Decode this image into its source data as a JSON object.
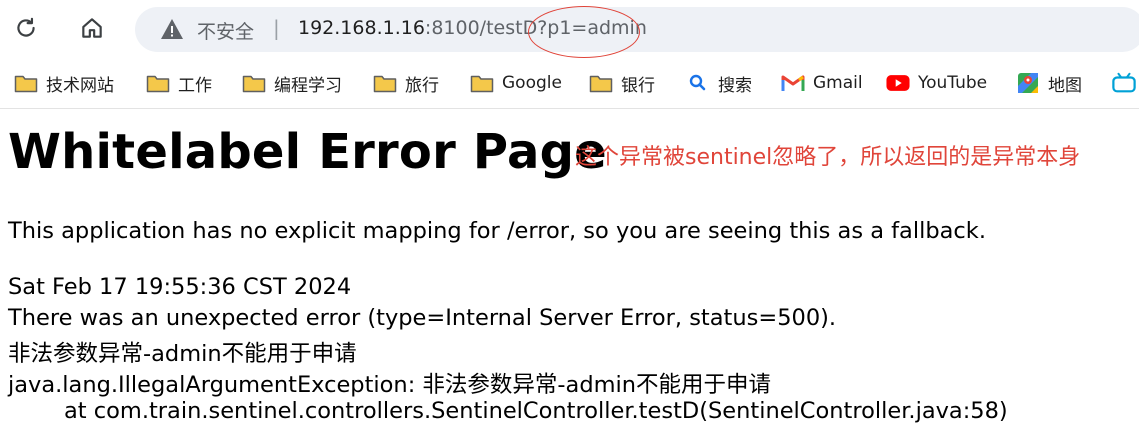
{
  "address_bar": {
    "security_label": "不安全",
    "separator": "|",
    "url_host": "192.168.1.16",
    "url_rest": ":8100/testD?p1=admin"
  },
  "bookmarks": [
    {
      "label": "技术网站",
      "icon": "folder-icon"
    },
    {
      "label": "工作",
      "icon": "folder-icon"
    },
    {
      "label": "编程学习",
      "icon": "folder-icon"
    },
    {
      "label": "旅行",
      "icon": "folder-icon"
    },
    {
      "label": "Google",
      "icon": "folder-icon"
    },
    {
      "label": "银行",
      "icon": "folder-icon"
    },
    {
      "label": "搜索",
      "icon": "search-icon"
    },
    {
      "label": "Gmail",
      "icon": "gmail-icon"
    },
    {
      "label": "YouTube",
      "icon": "youtube-icon"
    },
    {
      "label": "地图",
      "icon": "maps-icon"
    }
  ],
  "page": {
    "heading": "Whitelabel Error Page",
    "annotation": "这个异常被sentinel忽略了，所以返回的是异常本身",
    "description": "This application has no explicit mapping for /error, so you are seeing this as a fallback.",
    "timestamp": "Sat Feb 17 19:55:36 CST 2024",
    "error_summary": "There was an unexpected error (type=Internal Server Error, status=500).",
    "error_message": "非法参数异常-admin不能用于申请",
    "exception": "java.lang.IllegalArgumentException: 非法参数异常-admin不能用于申请",
    "stack_line_1": "at com.train.sentinel.controllers.SentinelController.testD(SentinelController.java:58)"
  },
  "colors": {
    "annotation": "#e0453a",
    "folder": "#f4c84a"
  }
}
